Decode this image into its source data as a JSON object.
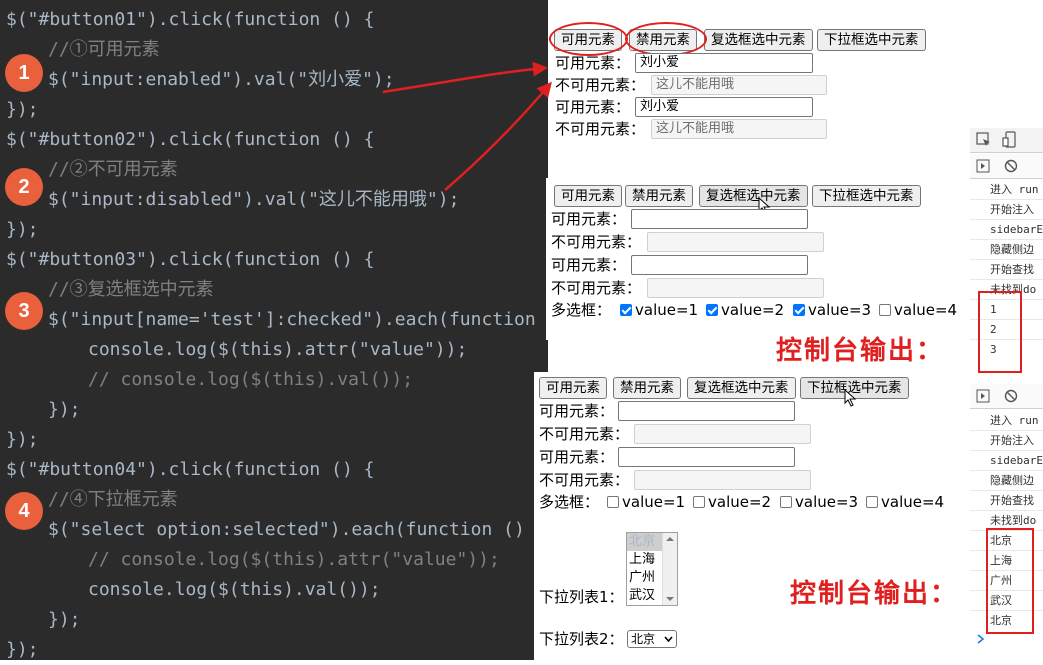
{
  "code": {
    "line_01": "$(\"#button01\").click(function () {",
    "line_02": "//①可用元素",
    "line_03": "$(\"input:enabled\").val(\"刘小爱\");",
    "line_04": "});",
    "line_05": "$(\"#button02\").click(function () {",
    "line_06": "//②不可用元素",
    "line_07": "$(\"input:disabled\").val(\"这儿不能用哦\");",
    "line_08": "});",
    "line_09": "$(\"#button03\").click(function () {",
    "line_10": "//③复选框选中元素",
    "line_11": "$(\"input[name='test']:checked\").each(function ()",
    "line_12": "console.log($(this).attr(\"value\"));",
    "line_13": "// console.log($(this).val());",
    "line_14": "});",
    "line_15": "});",
    "line_16": "$(\"#button04\").click(function () {",
    "line_17": "//④下拉框元素",
    "line_18": "$(\"select option:selected\").each(function () {",
    "line_19": "// console.log($(this).attr(\"value\"));",
    "line_20": "console.log($(this).val());",
    "line_21": "});",
    "line_22": "});",
    "badges": [
      "1",
      "2",
      "3",
      "4"
    ]
  },
  "buttons": {
    "b1": "可用元素",
    "b2": "禁用元素",
    "b3": "复选框选中元素",
    "b4": "下拉框选中元素"
  },
  "form": {
    "enabled_label": "可用元素：",
    "disabled_label": "不可用元素：",
    "checkbox_label": "多选框：",
    "select1_label": "下拉列表1：",
    "select2_label": "下拉列表2：",
    "enabled_value": "刘小爱",
    "disabled_value": "这儿不能用哦",
    "checkbox_options": [
      "value=1",
      "value=2",
      "value=3",
      "value=4"
    ],
    "list_options": [
      "北京",
      "上海",
      "广州",
      "武汉"
    ],
    "select2_value": "北京"
  },
  "console": {
    "heading": "控制台输出：",
    "log_lines": [
      "进入 run",
      "开始注入",
      "sidebarE",
      "隐藏侧边",
      "开始查找",
      "未找到do"
    ],
    "output_checkbox": [
      "1",
      "2",
      "3"
    ],
    "output_select": [
      "北京",
      "上海",
      "广州",
      "武汉",
      "北京"
    ]
  }
}
